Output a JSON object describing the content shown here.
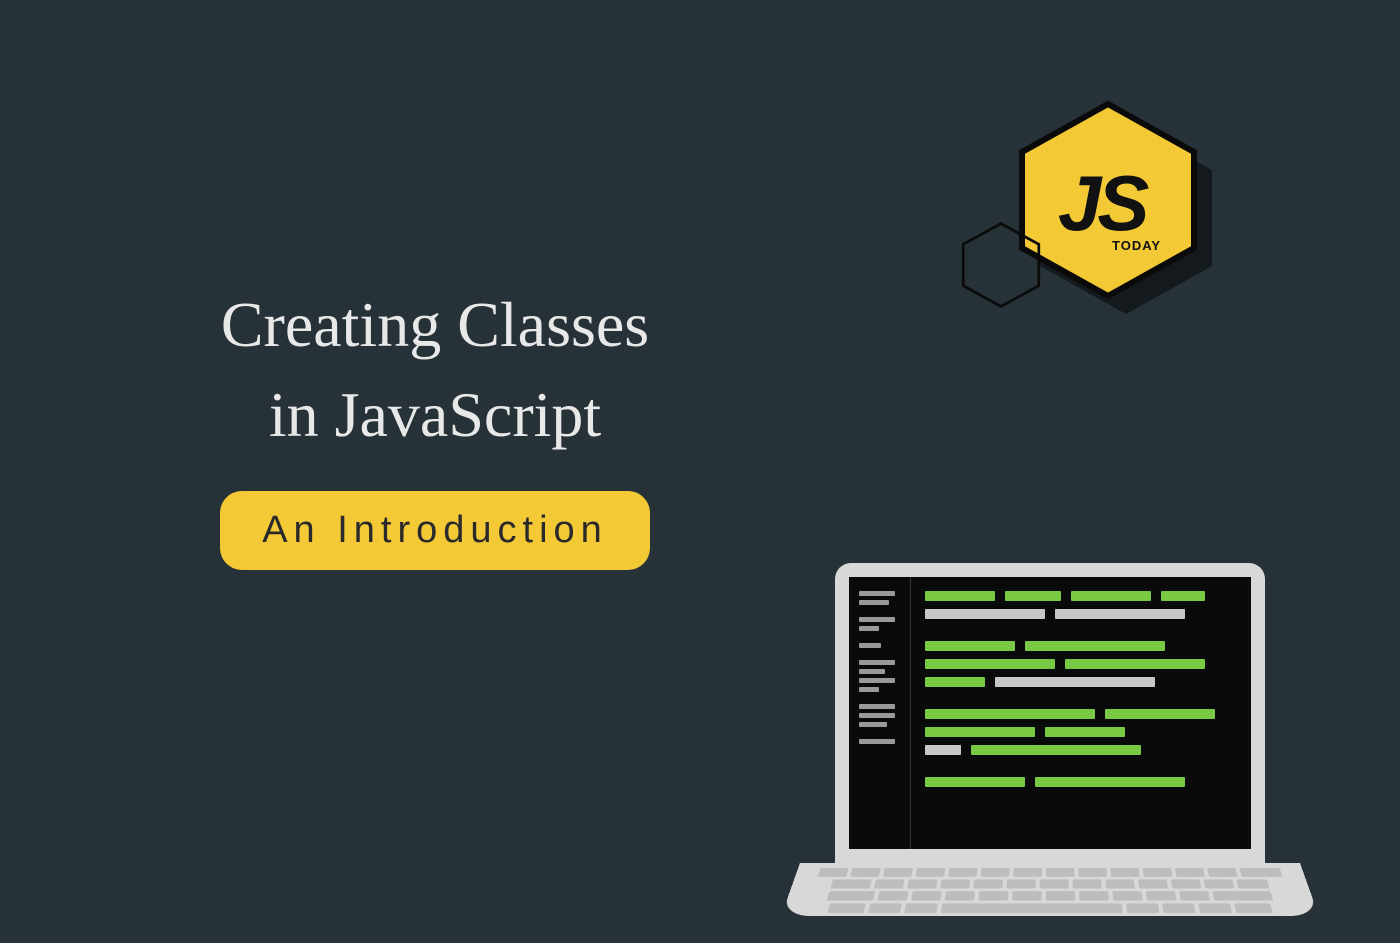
{
  "title": {
    "line1": "Creating Classes",
    "line2": "in JavaScript"
  },
  "subtitle": "An Introduction",
  "logo": {
    "main_text": "JS",
    "sub_text": "TODAY",
    "fill_color": "#f3c935",
    "shadow_color": "#1a1f22"
  },
  "background_color": "#263238",
  "laptop": {
    "code_colors": {
      "green": "#7ac943",
      "grey": "#c8c8c8"
    }
  }
}
